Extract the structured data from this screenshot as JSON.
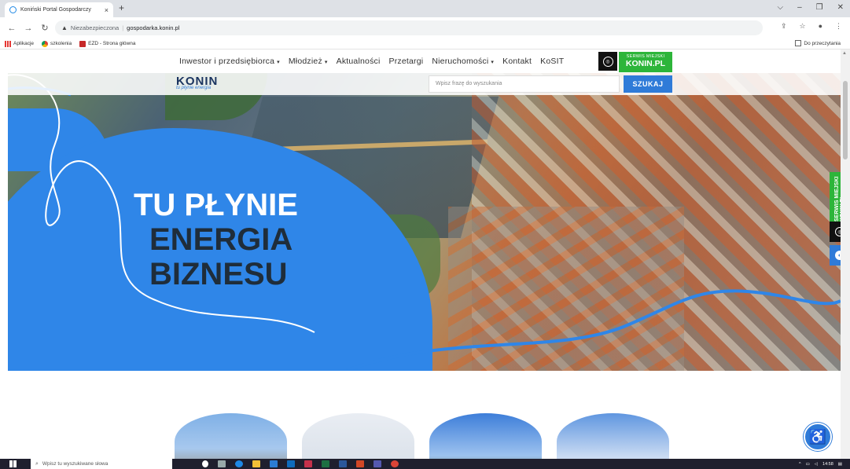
{
  "browser": {
    "tab_title": "Koniński Portal Gospodarczy",
    "tab_close": "×",
    "new_tab": "+",
    "window_controls": [
      "⌵",
      "–",
      "❐",
      "✕"
    ],
    "security_label": "Niezabezpieczona",
    "url": "gospodarka.konin.pl",
    "bookmarks": [
      "Aplikacje",
      "szkolenia",
      "EZD - Strona główna"
    ],
    "reading_list": "Do przeczytania"
  },
  "site": {
    "menu": [
      {
        "label": "Inwestor i przedsiębiorca",
        "caret": "▾"
      },
      {
        "label": "Młodzież",
        "caret": "▾"
      },
      {
        "label": "Aktualności",
        "caret": ""
      },
      {
        "label": "Przetargi",
        "caret": ""
      },
      {
        "label": "Nieruchomości",
        "caret": "▾"
      },
      {
        "label": "Kontakt",
        "caret": ""
      },
      {
        "label": "KoSIT",
        "caret": ""
      }
    ],
    "serwis_top": "SERWIS MIEJSKI",
    "serwis_bottom": "KONIN.PL",
    "logo_text": "KONIN",
    "logo_tagline": "tu płynie energia",
    "search_placeholder": "Wpisz frazę do wyszukania",
    "search_button": "SZUKAJ",
    "slogan": [
      "TU PŁYNIE",
      "ENERGIA",
      "BIZNESU"
    ],
    "side_serwis": "SERWIS MIEJSKI KONIN.PL"
  },
  "taskbar": {
    "search_placeholder": "Wpisz tu wyszukiwane słowa",
    "time": "14:58"
  },
  "colors": {
    "brand_blue": "#2f86e8",
    "brand_green": "#2db53a",
    "brand_navy": "#1f2d3a"
  }
}
